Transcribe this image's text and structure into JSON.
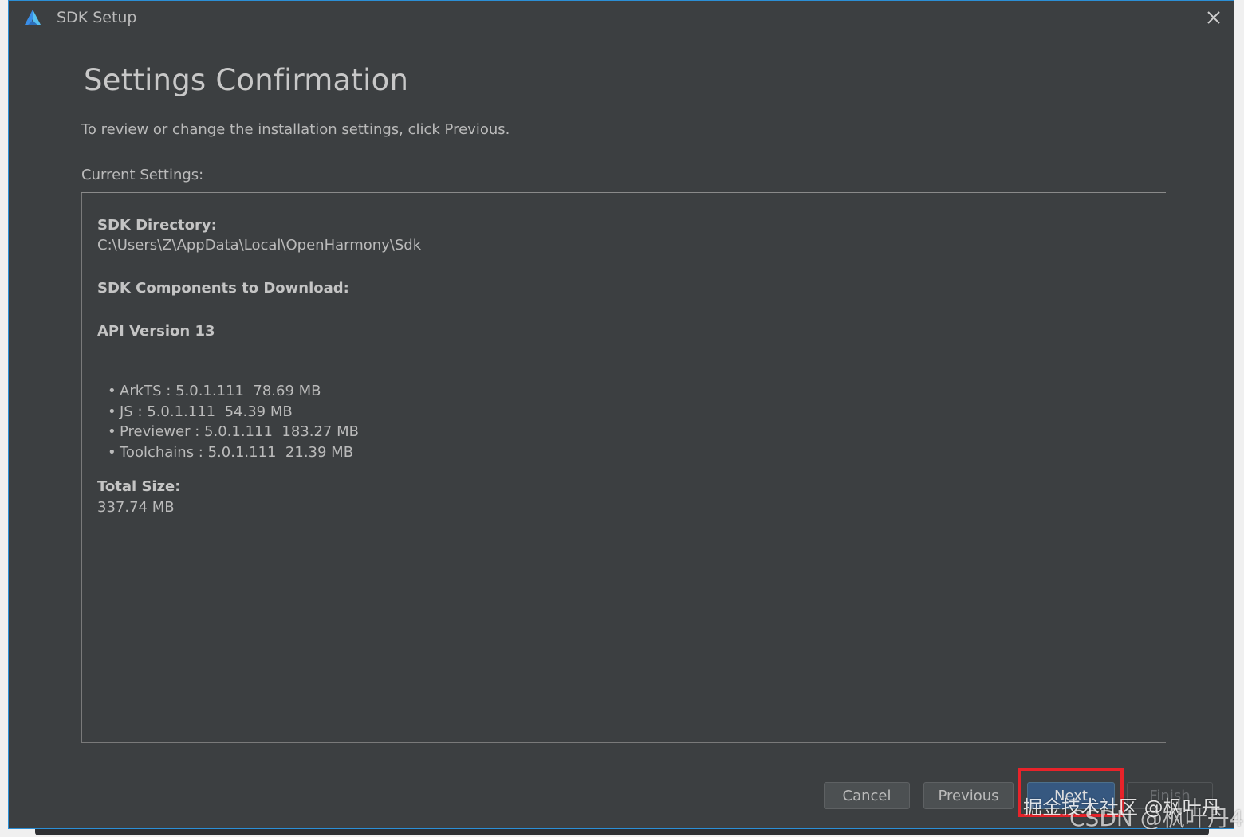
{
  "window": {
    "title": "SDK Setup",
    "accent_color": "#2b8fd6",
    "logo_icon": "deveco-logo-icon",
    "close_icon": "close-icon"
  },
  "page": {
    "heading": "Settings Confirmation",
    "subtitle": "To review or change the installation settings, click Previous.",
    "current_settings_label": "Current Settings:"
  },
  "settings": {
    "sdk_directory_label": "SDK Directory:",
    "sdk_directory_value": "C:\\Users\\Z\\AppData\\Local\\OpenHarmony\\Sdk",
    "components_label": "SDK Components to Download:",
    "api_version_label": "API Version 13",
    "components": [
      {
        "text": "ArkTS : 5.0.1.111  78.69 MB"
      },
      {
        "text": "JS : 5.0.1.111  54.39 MB"
      },
      {
        "text": "Previewer : 5.0.1.111  183.27 MB"
      },
      {
        "text": "Toolchains : 5.0.1.111  21.39 MB"
      }
    ],
    "total_size_label": "Total Size:",
    "total_size_value": "337.74 MB"
  },
  "buttons": {
    "cancel": "Cancel",
    "previous": "Previous",
    "next": "Next",
    "finish": "Finish"
  },
  "overlay": {
    "highlight_color": "#e8232a",
    "watermark_1": "掘金技术社区 @枫叶丹",
    "watermark_2": "CSDN @枫叶丹4"
  }
}
